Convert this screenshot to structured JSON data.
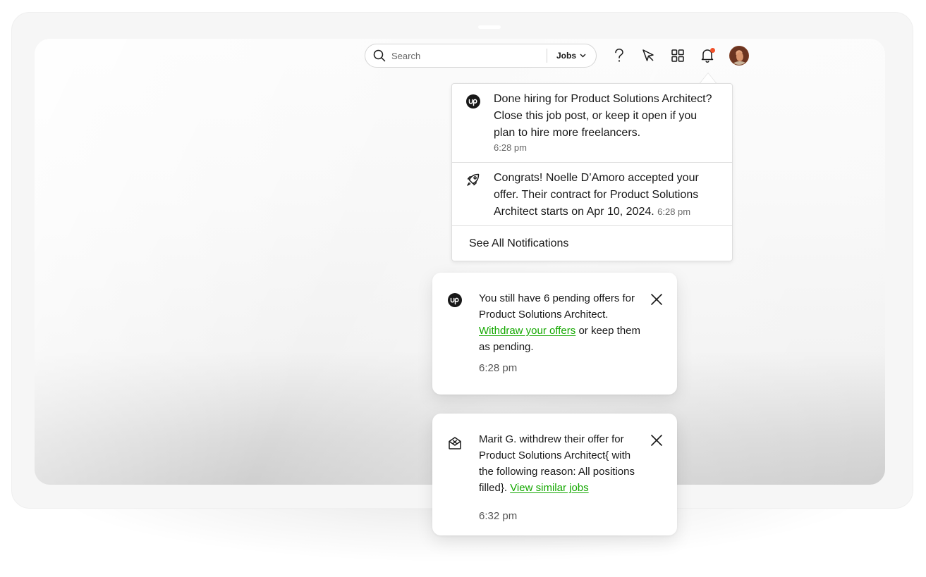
{
  "header": {
    "search": {
      "placeholder": "Search",
      "scope_label": "Jobs"
    },
    "icons": [
      "search-icon",
      "chevron-down-icon",
      "help-icon",
      "direct-contracts-icon",
      "apps-grid-icon",
      "bell-icon",
      "avatar"
    ],
    "notification_dot_color": "#f0502a"
  },
  "notifications_dropdown": {
    "items": [
      {
        "icon": "upwork-logo-icon",
        "text": "Done hiring for Product Solutions Architect? Close this job post, or keep it open if you plan to hire more freelancers.",
        "time": "6:28 pm"
      },
      {
        "icon": "rocket-icon",
        "text": "Congrats! Noelle D’Amoro accepted your offer. Their contract for Product Solutions Architect starts on Apr 10, 2024.",
        "time": "6:28 pm"
      }
    ],
    "see_all_label": "See All Notifications"
  },
  "toasts": [
    {
      "icon": "upwork-logo-icon",
      "text_before": "You still have 6 pending offers for Product Solutions Architect.",
      "link": "Withdraw your offers",
      "text_after": "or keep them as pending.",
      "time": "6:28 pm"
    },
    {
      "icon": "envelope-x-icon",
      "text_before": "Marit G. withdrew their offer for Product Solutions Architect{ with the following reason: All positions filled}.",
      "link": "View similar jobs",
      "time": "6:32 pm"
    }
  ],
  "colors": {
    "link": "#14a800",
    "badge": "#f0502a"
  }
}
